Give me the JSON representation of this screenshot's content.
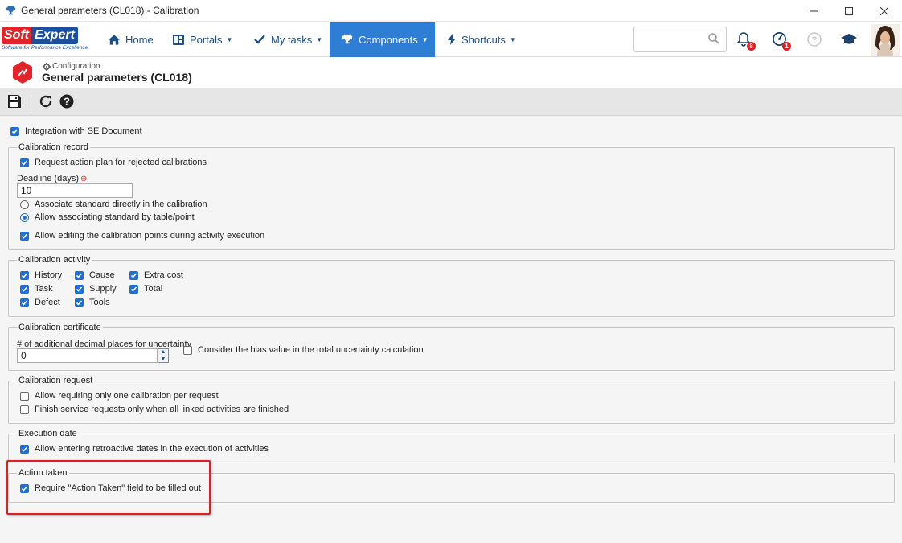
{
  "window": {
    "title": "General parameters (CL018) - Calibration",
    "app_icon": "trophy-icon",
    "controls": [
      "minimize-icon",
      "maximize-icon",
      "close-icon"
    ]
  },
  "brand": {
    "logo_soft": "Soft",
    "logo_expert": "Expert",
    "tagline": "Software for Performance Excellence",
    "accent": "#2e7ed6",
    "logo_red": "#e0242a",
    "logo_blue": "#1c4f9c"
  },
  "nav": {
    "items": [
      {
        "label": "Home",
        "icon": "home-icon",
        "has_caret": false,
        "active": false
      },
      {
        "label": "Portals",
        "icon": "portals-icon",
        "has_caret": true,
        "active": false
      },
      {
        "label": "My tasks",
        "icon": "checkmark-icon",
        "has_caret": true,
        "active": false
      },
      {
        "label": "Components",
        "icon": "trophy-icon",
        "has_caret": true,
        "active": true
      },
      {
        "label": "Shortcuts",
        "icon": "bolt-icon",
        "has_caret": true,
        "active": false
      }
    ],
    "search": {
      "placeholder": "",
      "value": ""
    },
    "notifications_count": "8",
    "performance_count": "1"
  },
  "header": {
    "breadcrumb": "Configuration",
    "title": "General parameters (CL018)"
  },
  "toolbar": {
    "buttons": [
      "save-icon",
      "refresh-icon",
      "help-icon"
    ]
  },
  "form": {
    "integration_se_document": {
      "label": "Integration with SE Document",
      "checked": true
    },
    "calibration_record": {
      "legend": "Calibration record",
      "request_action_plan": {
        "label": "Request action plan for rejected calibrations",
        "checked": true
      },
      "deadline_label": "Deadline (days)",
      "deadline_value": "10",
      "associate_direct": {
        "label": "Associate standard directly in the calibration",
        "selected": false
      },
      "associate_table": {
        "label": "Allow associating standard by table/point",
        "selected": true
      },
      "allow_editing_points": {
        "label": "Allow editing the calibration points during activity execution",
        "checked": true
      }
    },
    "calibration_activity": {
      "legend": "Calibration activity",
      "items": [
        {
          "label": "History",
          "checked": true
        },
        {
          "label": "Task",
          "checked": true
        },
        {
          "label": "Defect",
          "checked": true
        },
        {
          "label": "Cause",
          "checked": true
        },
        {
          "label": "Supply",
          "checked": true
        },
        {
          "label": "Tools",
          "checked": true
        },
        {
          "label": "Extra cost",
          "checked": true
        },
        {
          "label": "Total",
          "checked": true
        }
      ]
    },
    "calibration_certificate": {
      "legend": "Calibration certificate",
      "decimal_places_label": "# of additional decimal places for uncertainty",
      "decimal_places_value": "0",
      "bias_value": {
        "label": "Consider the bias value in the total uncertainty calculation",
        "checked": false
      }
    },
    "calibration_request": {
      "legend": "Calibration request",
      "one_per_request": {
        "label": "Allow requiring only one calibration per request",
        "checked": false
      },
      "finish_service": {
        "label": "Finish service requests only when all linked activities are finished",
        "checked": false
      }
    },
    "execution_date": {
      "legend": "Execution date",
      "retroactive": {
        "label": "Allow entering retroactive dates in the execution of activities",
        "checked": true
      }
    },
    "action_taken": {
      "legend": "Action taken",
      "require_field": {
        "label": "Require \"Action Taken\" field to be filled out",
        "checked": true
      }
    }
  }
}
